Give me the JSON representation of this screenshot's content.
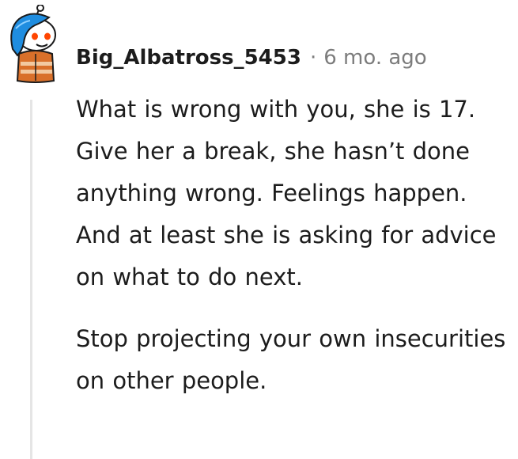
{
  "comment": {
    "author": "Big_Albatross_5453",
    "separator": "·",
    "timestamp": "6 mo. ago",
    "avatar_icon": "snoo-avatar-icon",
    "paragraphs": [
      "What is wrong with you, she is 17. Give her a break, she hasn’t done anything wrong. Feelings happen. And at least she is asking for advice on what to do next.",
      "Stop projecting your own insecurities on other people."
    ]
  },
  "colors": {
    "text": "#1c1c1c",
    "meta": "#7c7c7c",
    "thread_line": "#e5e5e5",
    "avatar_blue": "#1f8de0",
    "avatar_orange": "#d9702a"
  }
}
